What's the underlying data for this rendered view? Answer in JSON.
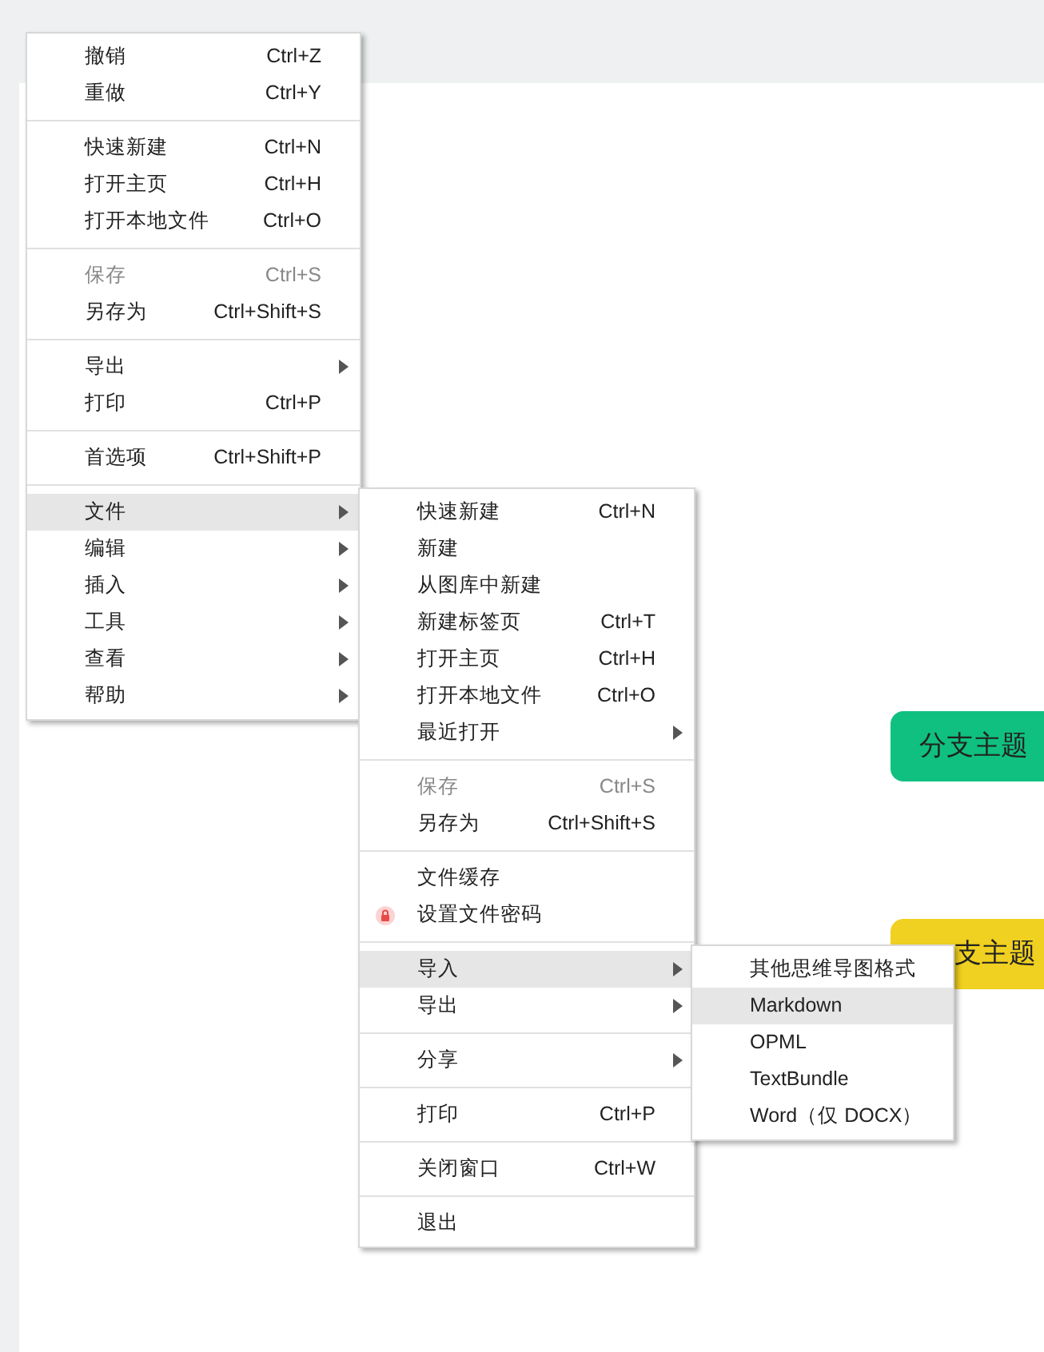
{
  "topics": [
    {
      "text": "分支主题",
      "color": "#10c080"
    },
    {
      "text": "支主题",
      "color": "#f0d020"
    }
  ],
  "menus": [
    {
      "items": [
        {
          "kind": "item",
          "label": "撤销",
          "shortcut": "Ctrl+Z",
          "disabled": false,
          "selected": false,
          "submenu": false,
          "locked": false
        },
        {
          "kind": "item",
          "label": "重做",
          "shortcut": "Ctrl+Y",
          "disabled": false,
          "selected": false,
          "submenu": false,
          "locked": false
        },
        {
          "kind": "separator"
        },
        {
          "kind": "item",
          "label": "快速新建",
          "shortcut": "Ctrl+N",
          "disabled": false,
          "selected": false,
          "submenu": false,
          "locked": false
        },
        {
          "kind": "item",
          "label": "打开主页",
          "shortcut": "Ctrl+H",
          "disabled": false,
          "selected": false,
          "submenu": false,
          "locked": false
        },
        {
          "kind": "item",
          "label": "打开本地文件",
          "shortcut": "Ctrl+O",
          "disabled": false,
          "selected": false,
          "submenu": false,
          "locked": false
        },
        {
          "kind": "separator"
        },
        {
          "kind": "item",
          "label": "保存",
          "shortcut": "Ctrl+S",
          "disabled": true,
          "selected": false,
          "submenu": false,
          "locked": false
        },
        {
          "kind": "item",
          "label": "另存为",
          "shortcut": "Ctrl+Shift+S",
          "disabled": false,
          "selected": false,
          "submenu": false,
          "locked": false
        },
        {
          "kind": "separator"
        },
        {
          "kind": "item",
          "label": "导出",
          "disabled": false,
          "selected": false,
          "submenu": true,
          "locked": false
        },
        {
          "kind": "item",
          "label": "打印",
          "shortcut": "Ctrl+P",
          "disabled": false,
          "selected": false,
          "submenu": false,
          "locked": false
        },
        {
          "kind": "separator"
        },
        {
          "kind": "item",
          "label": "首选项",
          "shortcut": "Ctrl+Shift+P",
          "disabled": false,
          "selected": false,
          "submenu": false,
          "locked": false
        },
        {
          "kind": "separator"
        },
        {
          "kind": "item",
          "label": "文件",
          "disabled": false,
          "selected": true,
          "submenu": true,
          "locked": false
        },
        {
          "kind": "item",
          "label": "编辑",
          "disabled": false,
          "selected": false,
          "submenu": true,
          "locked": false
        },
        {
          "kind": "item",
          "label": "插入",
          "disabled": false,
          "selected": false,
          "submenu": true,
          "locked": false
        },
        {
          "kind": "item",
          "label": "工具",
          "disabled": false,
          "selected": false,
          "submenu": true,
          "locked": false
        },
        {
          "kind": "item",
          "label": "查看",
          "disabled": false,
          "selected": false,
          "submenu": true,
          "locked": false
        },
        {
          "kind": "item",
          "label": "帮助",
          "disabled": false,
          "selected": false,
          "submenu": true,
          "locked": false
        }
      ]
    },
    {
      "items": [
        {
          "kind": "item",
          "label": "快速新建",
          "shortcut": "Ctrl+N",
          "disabled": false,
          "selected": false,
          "submenu": false,
          "locked": false
        },
        {
          "kind": "item",
          "label": "新建",
          "disabled": false,
          "selected": false,
          "submenu": false,
          "locked": false
        },
        {
          "kind": "item",
          "label": "从图库中新建",
          "disabled": false,
          "selected": false,
          "submenu": false,
          "locked": false
        },
        {
          "kind": "item",
          "label": "新建标签页",
          "shortcut": "Ctrl+T",
          "disabled": false,
          "selected": false,
          "submenu": false,
          "locked": false
        },
        {
          "kind": "item",
          "label": "打开主页",
          "shortcut": "Ctrl+H",
          "disabled": false,
          "selected": false,
          "submenu": false,
          "locked": false
        },
        {
          "kind": "item",
          "label": "打开本地文件",
          "shortcut": "Ctrl+O",
          "disabled": false,
          "selected": false,
          "submenu": false,
          "locked": false
        },
        {
          "kind": "item",
          "label": "最近打开",
          "disabled": false,
          "selected": false,
          "submenu": true,
          "locked": false
        },
        {
          "kind": "separator"
        },
        {
          "kind": "item",
          "label": "保存",
          "shortcut": "Ctrl+S",
          "disabled": true,
          "selected": false,
          "submenu": false,
          "locked": false
        },
        {
          "kind": "item",
          "label": "另存为",
          "shortcut": "Ctrl+Shift+S",
          "disabled": false,
          "selected": false,
          "submenu": false,
          "locked": false
        },
        {
          "kind": "separator"
        },
        {
          "kind": "item",
          "label": "文件缓存",
          "disabled": false,
          "selected": false,
          "submenu": false,
          "locked": false
        },
        {
          "kind": "item",
          "label": "设置文件密码",
          "disabled": false,
          "selected": false,
          "submenu": false,
          "locked": true
        },
        {
          "kind": "separator"
        },
        {
          "kind": "item",
          "label": "导入",
          "disabled": false,
          "selected": true,
          "submenu": true,
          "locked": false
        },
        {
          "kind": "item",
          "label": "导出",
          "disabled": false,
          "selected": false,
          "submenu": true,
          "locked": false
        },
        {
          "kind": "separator"
        },
        {
          "kind": "item",
          "label": "分享",
          "disabled": false,
          "selected": false,
          "submenu": true,
          "locked": false
        },
        {
          "kind": "separator"
        },
        {
          "kind": "item",
          "label": "打印",
          "shortcut": "Ctrl+P",
          "disabled": false,
          "selected": false,
          "submenu": false,
          "locked": false
        },
        {
          "kind": "separator"
        },
        {
          "kind": "item",
          "label": "关闭窗口",
          "shortcut": "Ctrl+W",
          "disabled": false,
          "selected": false,
          "submenu": false,
          "locked": false
        },
        {
          "kind": "separator"
        },
        {
          "kind": "item",
          "label": "退出",
          "disabled": false,
          "selected": false,
          "submenu": false,
          "locked": false
        }
      ]
    },
    {
      "items": [
        {
          "kind": "item",
          "label": "其他思维导图格式",
          "disabled": false,
          "selected": false,
          "submenu": false,
          "locked": false
        },
        {
          "kind": "item",
          "label": "Markdown",
          "disabled": false,
          "selected": true,
          "submenu": false,
          "locked": false
        },
        {
          "kind": "item",
          "label": "OPML",
          "disabled": false,
          "selected": false,
          "submenu": false,
          "locked": false
        },
        {
          "kind": "item",
          "label": "TextBundle",
          "disabled": false,
          "selected": false,
          "submenu": false,
          "locked": false
        },
        {
          "kind": "item",
          "label": "Word（仅 DOCX）",
          "disabled": false,
          "selected": false,
          "submenu": false,
          "locked": false
        }
      ]
    }
  ]
}
